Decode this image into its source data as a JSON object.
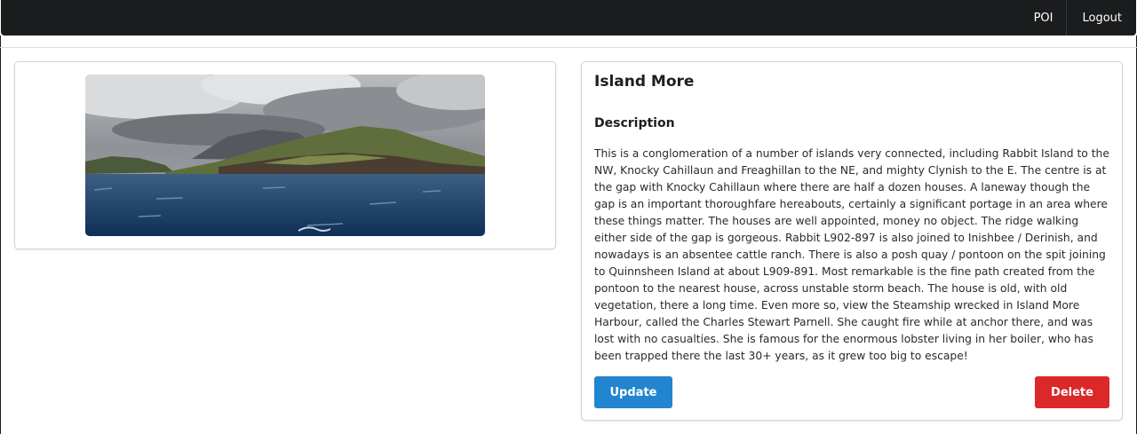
{
  "nav": {
    "items": [
      {
        "label": "POI"
      },
      {
        "label": "Logout"
      }
    ]
  },
  "poi": {
    "name": "Island More",
    "description_heading": "Description",
    "description": "This is a conglomeration of a number of islands very connected, including Rabbit Island to the NW, Knocky Cahillaun and Freaghillan to the NE, and mighty Clynish to the E. The centre is at the gap with Knocky Cahillaun where there are half a dozen houses. A laneway though the gap is an important thoroughfare hereabouts, certainly a significant portage in an area where these things matter. The houses are well appointed, money no object. The ridge walking either side of the gap is gorgeous. Rabbit L902-897 is also joined to Inishbee / Derinish, and nowadays is an absentee cattle ranch. There is also a posh quay / pontoon on the spit joining to Quinnsheen Island at about L909-891. Most remarkable is the fine path created from the pontoon to the nearest house, across unstable storm beach. The house is old, with old vegetation, there a long time. Even more so, view the Steamship wrecked in Island More Harbour, called the Charles Stewart Parnell. She caught fire while at anchor there, and was lost with no casualties. She is famous for the enormous lobster living in her boiler, who has been trapped there the last 30+ years, as it grew too big to escape!"
  },
  "actions": {
    "update_label": "Update",
    "delete_label": "Delete"
  },
  "colors": {
    "navbar": "#1b1c1d",
    "update": "#2185d0",
    "delete": "#db2828"
  }
}
